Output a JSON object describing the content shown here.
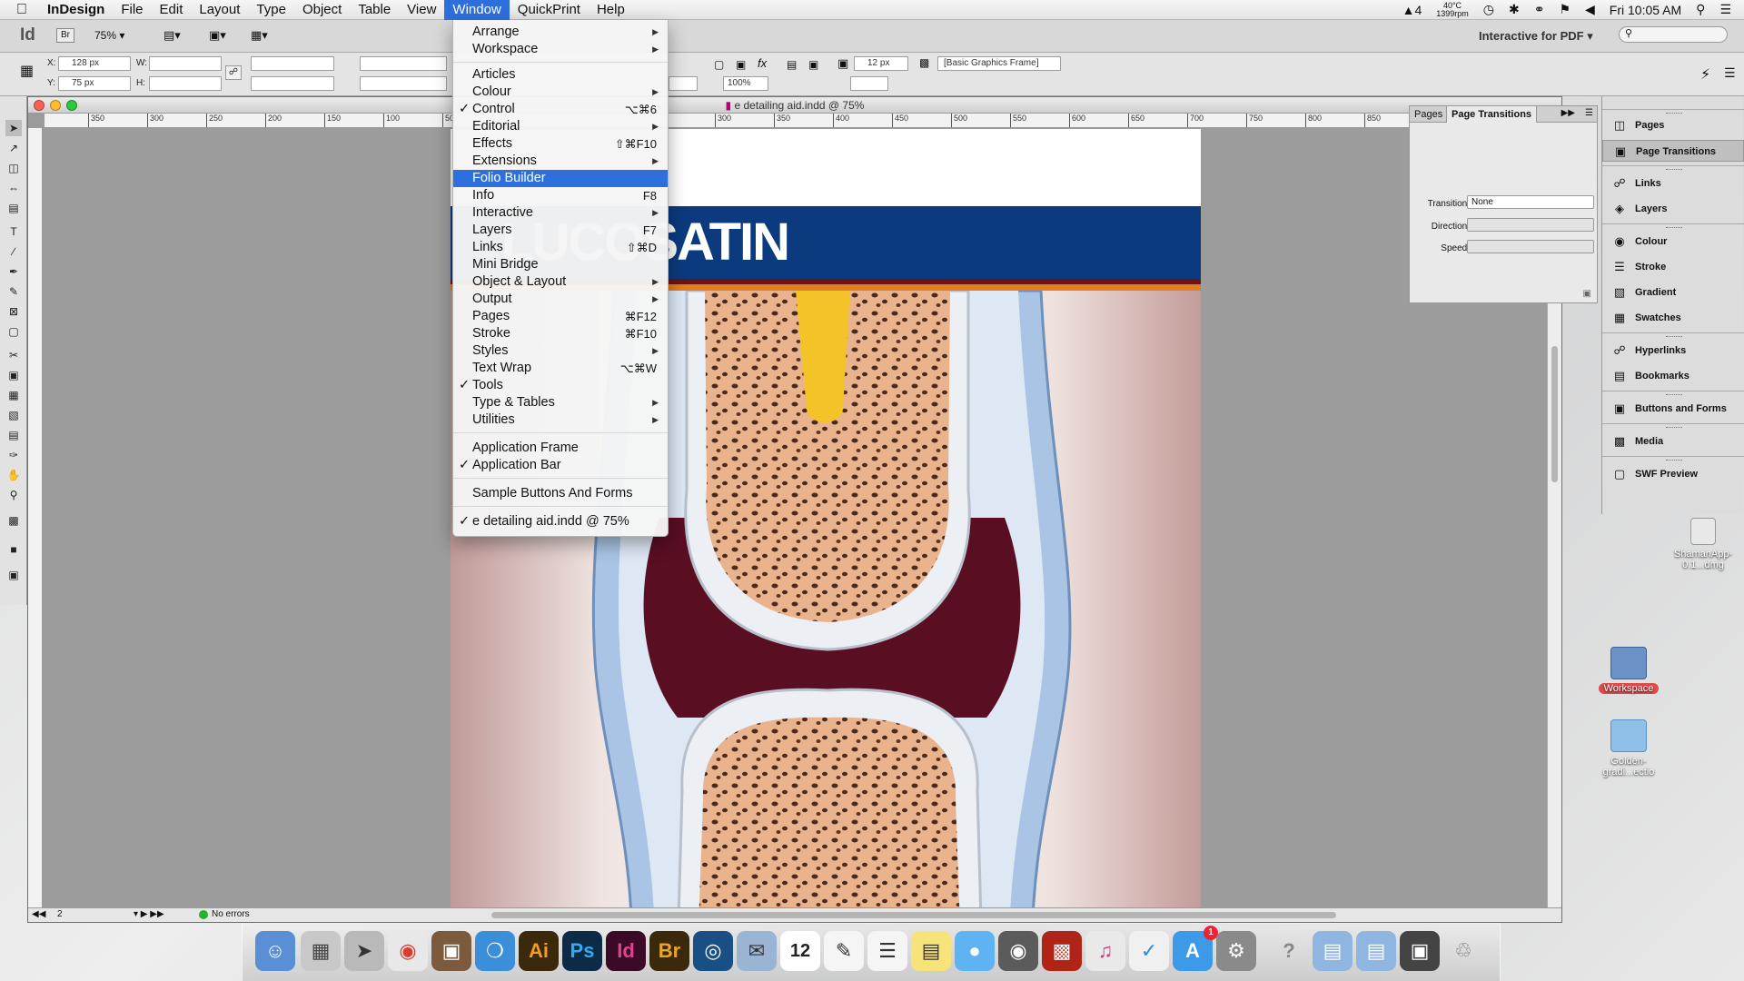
{
  "menubar": {
    "app_name": "InDesign",
    "items": [
      "File",
      "Edit",
      "Layout",
      "Type",
      "Object",
      "Table",
      "View",
      "Window",
      "QuickPrint",
      "Help"
    ],
    "active": "Window",
    "status": {
      "adobe_badge": "4",
      "temp": "40°C",
      "fan": "1399rpm",
      "clock": "Fri 10:05 AM"
    }
  },
  "appbar": {
    "logo": "Id",
    "bridge": "Br",
    "zoom": "75%",
    "workspace": "Interactive for PDF",
    "search_placeholder": ""
  },
  "control": {
    "x_label": "X:",
    "x_value": "128 px",
    "y_label": "Y:",
    "y_value": "75 px",
    "w_label": "W:",
    "h_label": "H:",
    "stroke_value": "12 px",
    "opacity_value": "100%",
    "object_style": "[Basic Graphics Frame]"
  },
  "document": {
    "title": "e detailing aid.indd @ 75%",
    "ruler_labels": [
      "350",
      "300",
      "250",
      "200",
      "150",
      "100",
      "50",
      "0",
      "300",
      "350",
      "400",
      "450",
      "500",
      "550",
      "600",
      "650",
      "700",
      "750",
      "800",
      "850",
      "900",
      "950"
    ],
    "page_number": "2",
    "preflight": "No errors",
    "brand_text": "LUCOSATIN"
  },
  "window_menu": {
    "items": [
      {
        "label": "Arrange",
        "submenu": true
      },
      {
        "label": "Workspace",
        "submenu": true
      },
      {
        "label": "Articles"
      },
      {
        "label": "Colour",
        "submenu": true
      },
      {
        "label": "Control",
        "checked": true,
        "shortcut": "⌥⌘6"
      },
      {
        "label": "Editorial",
        "submenu": true
      },
      {
        "label": "Effects",
        "shortcut": "⇧⌘F10"
      },
      {
        "label": "Extensions",
        "submenu": true
      },
      {
        "label": "Folio Builder",
        "highlighted": true
      },
      {
        "label": "Info",
        "shortcut": "F8"
      },
      {
        "label": "Interactive",
        "submenu": true
      },
      {
        "label": "Layers",
        "shortcut": "F7"
      },
      {
        "label": "Links",
        "shortcut": "⇧⌘D"
      },
      {
        "label": "Mini Bridge"
      },
      {
        "label": "Object & Layout",
        "submenu": true
      },
      {
        "label": "Output",
        "submenu": true
      },
      {
        "label": "Pages",
        "shortcut": "⌘F12"
      },
      {
        "label": "Stroke",
        "shortcut": "⌘F10"
      },
      {
        "label": "Styles",
        "submenu": true
      },
      {
        "label": "Text Wrap",
        "shortcut": "⌥⌘W"
      },
      {
        "label": "Tools",
        "checked": true
      },
      {
        "label": "Type & Tables",
        "submenu": true
      },
      {
        "label": "Utilities",
        "submenu": true
      },
      {
        "label": "Application Frame"
      },
      {
        "label": "Application Bar",
        "checked": true
      },
      {
        "label": "Sample Buttons And Forms"
      },
      {
        "label": "e detailing aid.indd @ 75%",
        "checked": true
      }
    ]
  },
  "page_transitions_panel": {
    "tab_pages": "Pages",
    "tab_transitions": "Page Transitions",
    "transition_label": "Transition:",
    "transition_value": "None",
    "direction_label": "Direction:",
    "direction_value": "",
    "speed_label": "Speed:",
    "speed_value": ""
  },
  "panel_dock": {
    "items": [
      "Pages",
      "Page Transitions",
      "Links",
      "Layers",
      "Colour",
      "Stroke",
      "Gradient",
      "Swatches",
      "Hyperlinks",
      "Bookmarks",
      "Buttons and Forms",
      "Media",
      "SWF Preview"
    ],
    "active": "Page Transitions"
  },
  "desktop": {
    "icons": [
      "ShamanApp-0.1...dmg",
      "Workspace",
      "Golden-gradi...ectio"
    ]
  },
  "dock": {
    "apps": [
      "Finder",
      "Calculator",
      "Launchpad",
      "Chrome",
      "Photo Booth",
      "Safari",
      "Ai",
      "Ps",
      "Id",
      "Br",
      "Skype",
      "Mail",
      "Calendar",
      "TextEdit",
      "Reminders",
      "Stickies",
      "Messages",
      "FaceTime",
      "Photo Slideshow",
      "iTunes",
      "FileZilla",
      "App Store",
      "System Preferences",
      "Help",
      "Documents",
      "Applications",
      "Screenshots",
      "Trash"
    ],
    "calendar_day": "12",
    "appstore_badge": "1"
  },
  "colors": {
    "menu_highlight": "#2e6fde",
    "brand_blue": "#0b3a7e",
    "brand_orange": "#e07f22"
  }
}
